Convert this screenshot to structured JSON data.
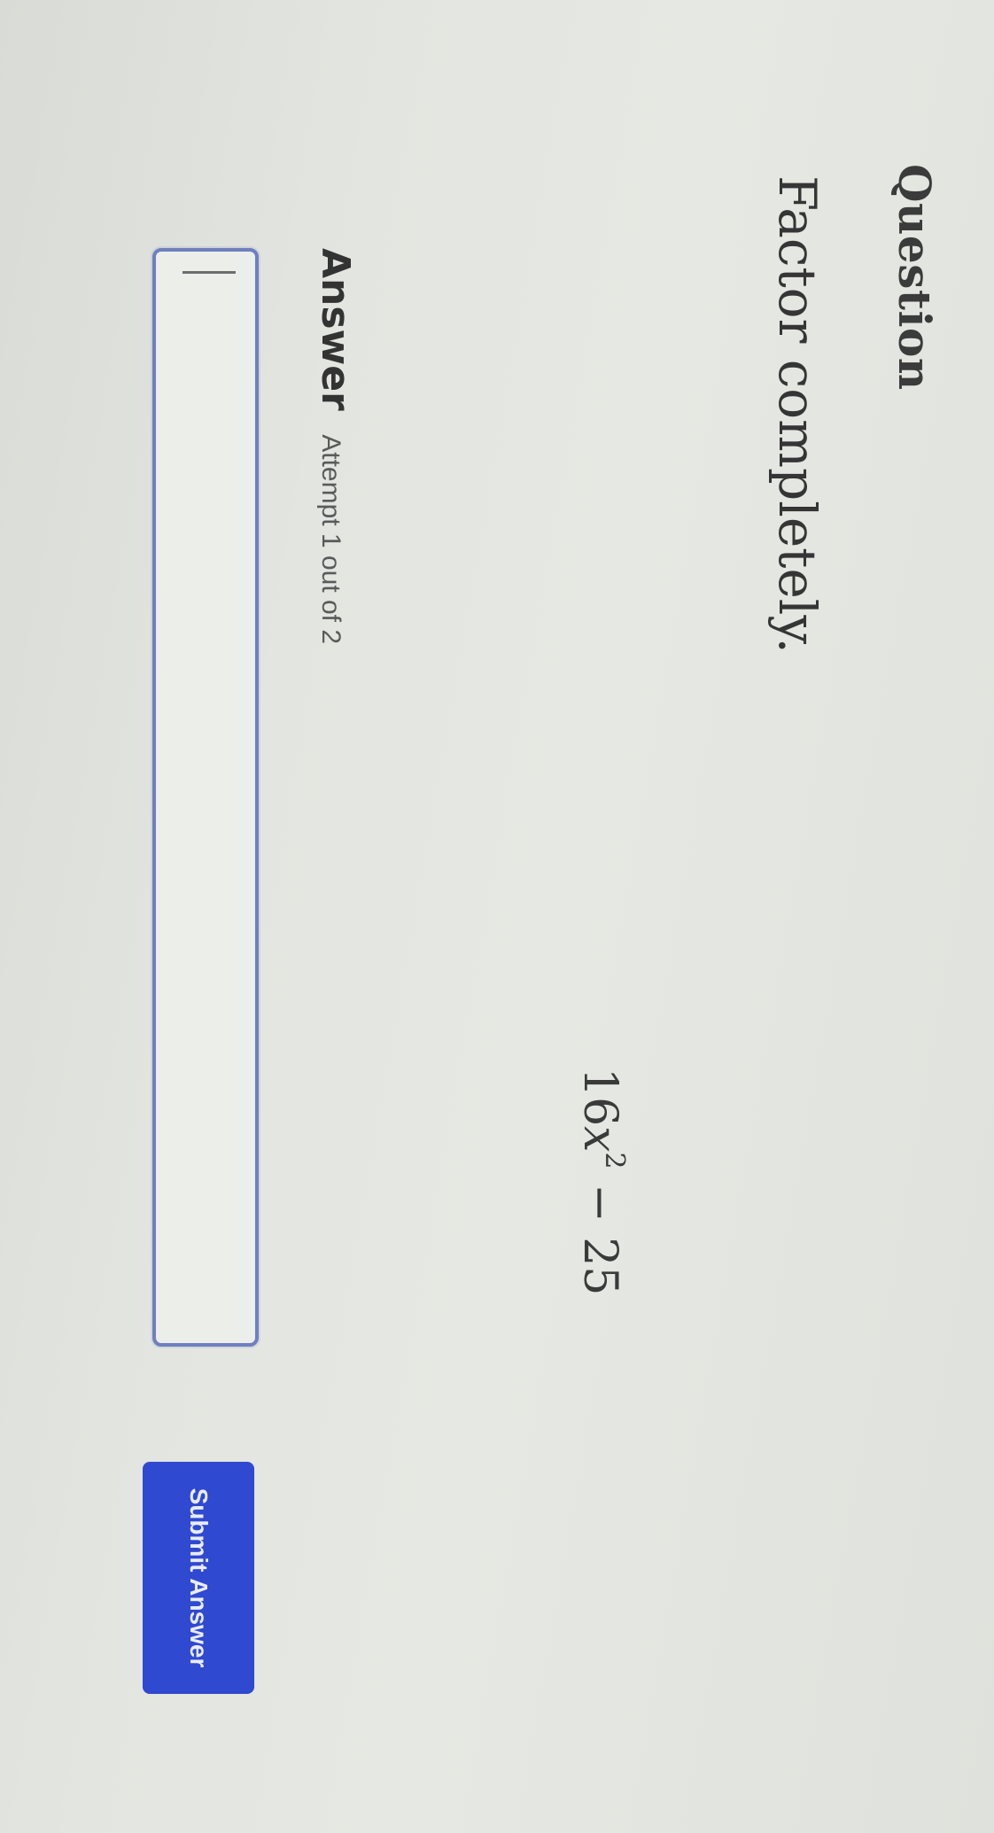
{
  "question": {
    "heading": "Question",
    "prompt": "Factor completely.",
    "expression": {
      "coefficient": "16",
      "variable": "x",
      "exponent": "2",
      "rest": " − 25"
    }
  },
  "answer": {
    "label": "Answer",
    "attempt_text": "Attempt 1 out of 2",
    "input_value": "",
    "submit_label": "Submit Answer"
  },
  "colors": {
    "submit_button": "#2f49d0",
    "input_border": "#6f7fc0",
    "background": "#e3e5e0"
  }
}
